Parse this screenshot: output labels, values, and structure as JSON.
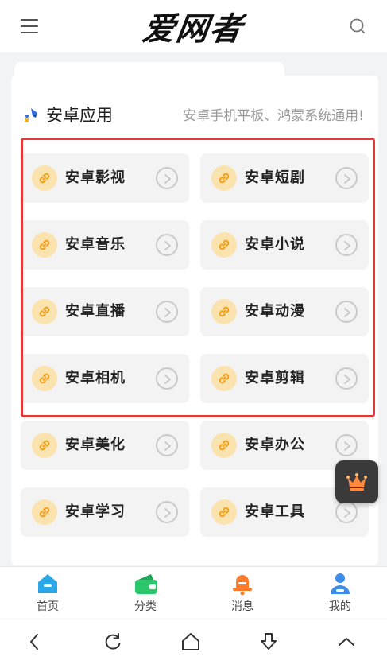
{
  "header": {
    "logo_text": "爱网者",
    "menu_icon": "hamburger-menu-icon",
    "search_icon": "search-icon"
  },
  "section": {
    "title": "安卓应用",
    "description": "安卓手机平板、鸿蒙系统通用!",
    "title_icon": "pin-icon"
  },
  "items": [
    {
      "label": "安卓影视"
    },
    {
      "label": "安卓短剧"
    },
    {
      "label": "安卓音乐"
    },
    {
      "label": "安卓小说"
    },
    {
      "label": "安卓直播"
    },
    {
      "label": "安卓动漫"
    },
    {
      "label": "安卓相机"
    },
    {
      "label": "安卓剪辑"
    },
    {
      "label": "安卓美化"
    },
    {
      "label": "安卓办公"
    },
    {
      "label": "安卓学习"
    },
    {
      "label": "安卓工具"
    }
  ],
  "floating_button": {
    "icon": "crown-icon"
  },
  "bottom_nav": [
    {
      "label": "首页",
      "icon": "home-icon"
    },
    {
      "label": "分类",
      "icon": "wallet-icon"
    },
    {
      "label": "消息",
      "icon": "bell-icon"
    },
    {
      "label": "我的",
      "icon": "user-icon"
    }
  ],
  "system_bar": {
    "buttons": [
      "back-icon",
      "refresh-icon",
      "home-icon",
      "download-icon",
      "up-icon"
    ]
  },
  "colors": {
    "highlight_border": "#e03a3a",
    "link_icon_bg": "#fbe3b0",
    "link_icon": "#f0a020",
    "nav_home": "#2aa7e6",
    "nav_category": "#2cc76a",
    "nav_message": "#ff7a2a",
    "nav_me": "#3b8de8"
  }
}
